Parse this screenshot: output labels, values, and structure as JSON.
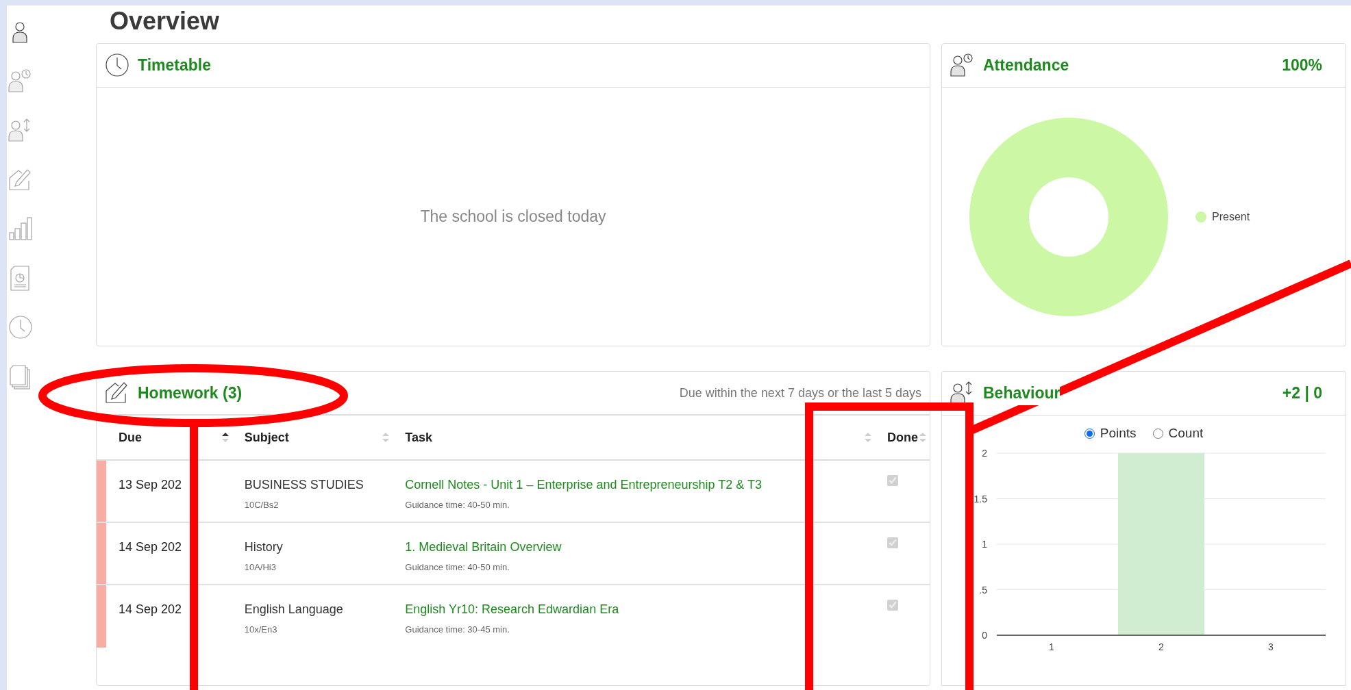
{
  "sidebar": {
    "items": [
      {
        "selected": true
      },
      {
        "selected": false
      },
      {
        "selected": false
      },
      {
        "selected": false
      },
      {
        "selected": false
      },
      {
        "selected": false
      },
      {
        "selected": false
      },
      {
        "selected": false
      }
    ]
  },
  "page_title": "Overview",
  "timetable": {
    "title": "Timetable",
    "message": "The school is closed today"
  },
  "attendance": {
    "title": "Attendance",
    "value": "100%",
    "legend": [
      {
        "label": "Present",
        "color": "#ccf7a4"
      }
    ]
  },
  "homework": {
    "title": "Homework (3)",
    "note": "Due within the next 7 days or the last 5 days",
    "columns": [
      {
        "label": "Due",
        "sorted": true
      },
      {
        "label": "Subject",
        "sorted": false
      },
      {
        "label": "Task",
        "sorted": false
      },
      {
        "label": "Done",
        "sorted": false
      }
    ],
    "rows": [
      {
        "due": "13 Sep 202",
        "subject": "BUSINESS STUDIES",
        "group": "10C/Bs2",
        "task": "Cornell Notes - Unit 1 – Enterprise and Entrepreneurship T2 & T3",
        "guidance": "Guidance time: 40-50 min.",
        "done": true,
        "color": "#f9aca4"
      },
      {
        "due": "14 Sep 202",
        "subject": "History",
        "group": "10A/Hi3",
        "task": "1. Medieval Britain Overview",
        "guidance": "Guidance time: 40-50 min.",
        "done": true,
        "color": "#f9aca4"
      },
      {
        "due": "14 Sep 202",
        "subject": "English Language",
        "group": "10x/En3",
        "task": "English Yr10: Research Edwardian Era",
        "guidance": "Guidance time: 30-45 min.",
        "done": true,
        "color": "#f9aca4"
      }
    ]
  },
  "behaviour": {
    "title": "Behaviour",
    "value": "+2 | 0",
    "modes": [
      {
        "label": "Points",
        "selected": true
      },
      {
        "label": "Count",
        "selected": false
      }
    ],
    "chart_data": {
      "type": "bar",
      "categories": [
        "1",
        "2",
        "3"
      ],
      "series": [
        {
          "color": "#d1edd1",
          "values": [
            0,
            2,
            0
          ]
        }
      ],
      "grid": true,
      "ylim": [
        0,
        2
      ],
      "yticks": [
        0,
        {
          "value": 0.5,
          "label": ".5"
        },
        {
          "value": 1,
          "label": "1"
        },
        {
          "value": 1.5,
          "label": "1.5"
        },
        2
      ]
    }
  }
}
